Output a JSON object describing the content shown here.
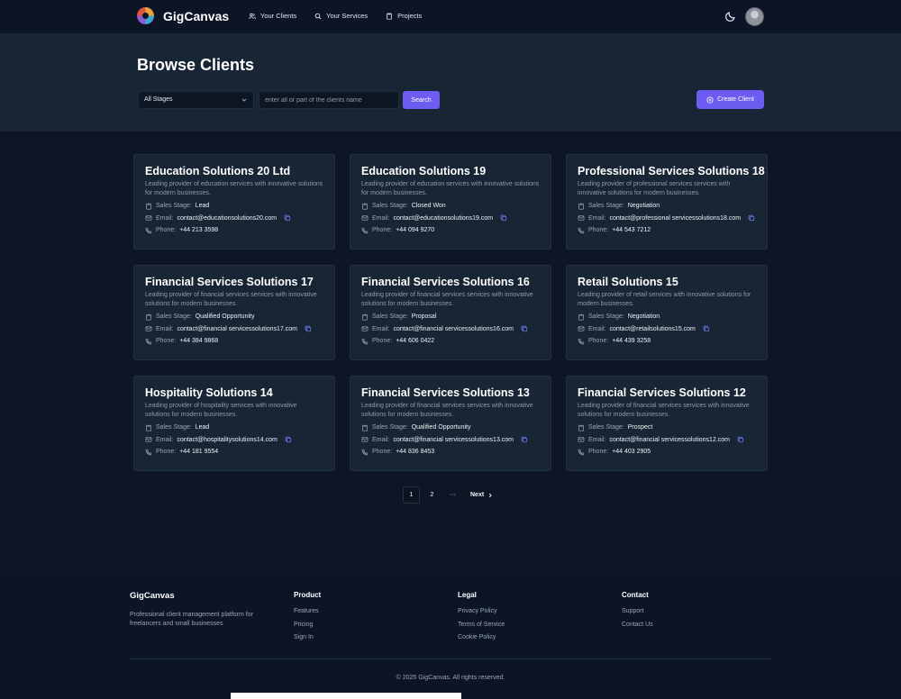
{
  "app": {
    "name": "GigCanvas"
  },
  "nav": [
    {
      "label": "Your Clients",
      "icon": "users-icon"
    },
    {
      "label": "Your Services",
      "icon": "search-icon"
    },
    {
      "label": "Projects",
      "icon": "clipboard-icon"
    }
  ],
  "header": {
    "theme_icon": "moon-icon",
    "avatar_icon": "user-avatar"
  },
  "page": {
    "title": "Browse Clients",
    "stage_select": "All Stages",
    "search_placeholder": "enter all or part of the clients name",
    "search_label": "Search",
    "create_label": "Create Client"
  },
  "labels": {
    "stage": "Sales Stage:",
    "email": "Email:",
    "phone": "Phone:"
  },
  "clients": [
    {
      "name": "Education Solutions 20 Ltd",
      "description": "Leading provider of education services with innovative solutions for modern businesses.",
      "stage": "Lead",
      "email": "contact@educationsolutions20.com",
      "phone": "+44 213 3598"
    },
    {
      "name": "Education Solutions 19",
      "description": "Leading provider of education services with innovative solutions for modern businesses.",
      "stage": "Closed Won",
      "email": "contact@educationsolutions19.com",
      "phone": "+44 094 9270"
    },
    {
      "name": "Professional Services Solutions 18",
      "description": "Leading provider of professional services services with innovative solutions for modern businesses.",
      "stage": "Negotiation",
      "email": "contact@professional servicessolutions18.com",
      "phone": "+44 543 7212"
    },
    {
      "name": "Financial Services Solutions 17",
      "description": "Leading provider of financial services services with innovative solutions for modern businesses.",
      "stage": "Qualified Opportunity",
      "email": "contact@financial servicessolutions17.com",
      "phone": "+44 384 9868"
    },
    {
      "name": "Financial Services Solutions 16",
      "description": "Leading provider of financial services services with innovative solutions for modern businesses.",
      "stage": "Proposal",
      "email": "contact@financial servicessolutions16.com",
      "phone": "+44 606 0422"
    },
    {
      "name": "Retail Solutions 15",
      "description": "Leading provider of retail services with innovative solutions for modern businesses.",
      "stage": "Negotiation",
      "email": "contact@retailsolutions15.com",
      "phone": "+44 439 3258"
    },
    {
      "name": "Hospitality Solutions 14",
      "description": "Leading provider of hospitality services with innovative solutions for modern businesses.",
      "stage": "Lead",
      "email": "contact@hospitalitysolutions14.com",
      "phone": "+44 181 9554"
    },
    {
      "name": "Financial Services Solutions 13",
      "description": "Leading provider of financial services services with innovative solutions for modern businesses.",
      "stage": "Qualified Opportunity",
      "email": "contact@financial servicessolutions13.com",
      "phone": "+44 836 8453"
    },
    {
      "name": "Financial Services Solutions 12",
      "description": "Leading provider of financial services services with innovative solutions for modern businesses.",
      "stage": "Prospect",
      "email": "contact@financial servicessolutions12.com",
      "phone": "+44 403 2905"
    }
  ],
  "pagination": {
    "pages": [
      "1",
      "2"
    ],
    "current": "1",
    "ellipsis": "···",
    "next": "Next"
  },
  "footer": {
    "brand": "GigCanvas",
    "tagline": "Professional client management platform for freelancers and small businesses",
    "columns": [
      {
        "heading": "Product",
        "links": [
          "Features",
          "Pricing",
          "Sign In"
        ]
      },
      {
        "heading": "Legal",
        "links": [
          "Privacy Policy",
          "Terms of Service",
          "Cookie Policy"
        ]
      },
      {
        "heading": "Contact",
        "links": [
          "Support",
          "Contact Us"
        ]
      }
    ],
    "copyright": "© 2025 GigCanvas. All rights reserved."
  },
  "colors": {
    "accent": "#6c5cf0",
    "background": "#0e1626",
    "card": "#172534",
    "header": "#0c1526"
  }
}
